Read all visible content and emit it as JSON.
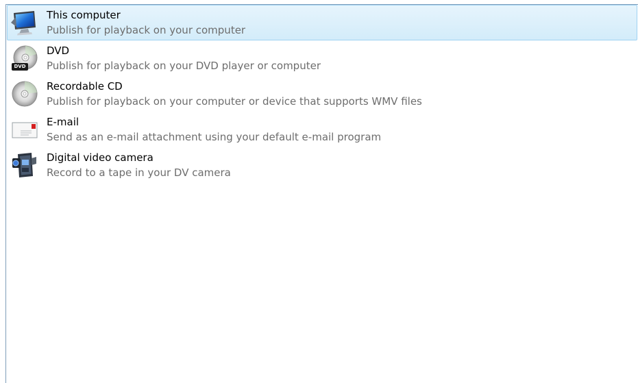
{
  "publish_options": [
    {
      "title": "This computer",
      "description": "Publish for playback on your computer",
      "icon": "monitor-icon",
      "selected": true
    },
    {
      "title": "DVD",
      "description": "Publish for playback on your DVD player or computer",
      "icon": "dvd-disc-icon",
      "selected": false
    },
    {
      "title": "Recordable CD",
      "description": "Publish for playback on your computer or device that supports WMV files",
      "icon": "cd-disc-icon",
      "selected": false
    },
    {
      "title": "E-mail",
      "description": "Send as an e-mail attachment using your default e-mail program",
      "icon": "email-envelope-icon",
      "selected": false
    },
    {
      "title": "Digital video camera",
      "description": "Record to a tape in your DV camera",
      "icon": "camcorder-icon",
      "selected": false
    }
  ],
  "icon_labels": {
    "dvd_badge": "DVD"
  },
  "colors": {
    "selection_bg": "#d3ecfa",
    "selection_border": "#9fd2f2",
    "description_text": "#6d6d6d"
  }
}
